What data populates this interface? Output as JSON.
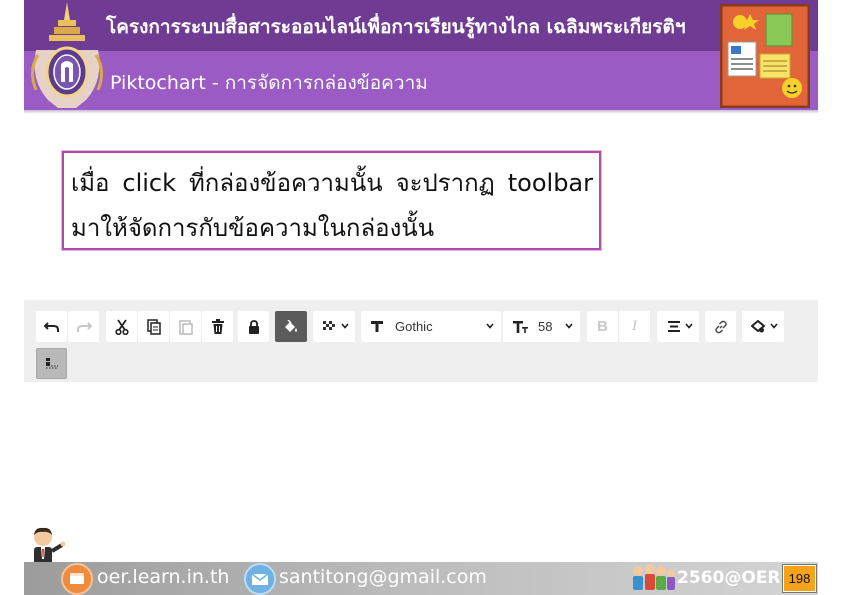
{
  "header": {
    "title": "โครงการระบบสื่อสาระออนไลน์เพื่อการเรียนรู้ทางไกล เฉลิมพระเกียรติฯ",
    "subtitle": "Piktochart - การจัดการกล่องข้อความ",
    "colors": {
      "band_dark": "#6f3b93",
      "band_light": "#9a5bc4"
    }
  },
  "callout": {
    "text": "เมื่อ click ที่กล่องข้อความนั้น จะปรากฏ toolbar มาให้จัดการกับข้อความในกล่องนั้น",
    "border_color": "#b04aa6"
  },
  "toolbar": {
    "font_select": {
      "value": "Gothic"
    },
    "size_select": {
      "value": "58"
    },
    "icons": [
      "undo-icon",
      "redo-icon",
      "cut-icon",
      "copy-icon",
      "paste-icon",
      "delete-icon",
      "lock-icon",
      "fill-bucket-icon",
      "transparency-icon",
      "text-icon",
      "text-size-icon",
      "bold-icon",
      "italic-icon",
      "align-icon",
      "link-icon",
      "effects-icon",
      "arrange-icon"
    ],
    "bold_label": "B",
    "italic_label": "I"
  },
  "footer": {
    "site": "oer.learn.in.th",
    "email": "santitong@gmail.com",
    "project": "2560@OER",
    "page_number": "198"
  }
}
